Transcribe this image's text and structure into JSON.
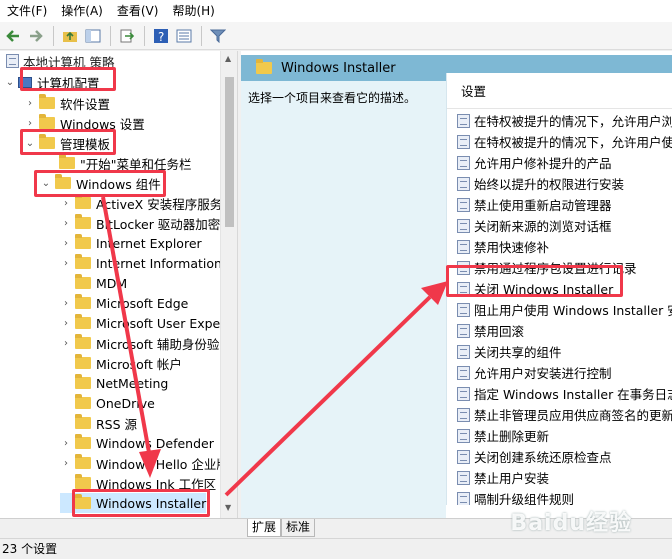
{
  "menu": [
    "文件(F)",
    "操作(A)",
    "查看(V)",
    "帮助(H)"
  ],
  "tree": {
    "root": "本地计算机 策略",
    "items": [
      {
        "label": "计算机配置",
        "level": 0,
        "expanded": true,
        "icon": "computer-icon"
      },
      {
        "label": "软件设置",
        "level": 1
      },
      {
        "label": "Windows 设置",
        "level": 1
      },
      {
        "label": "管理模板",
        "level": 1,
        "expanded": true
      },
      {
        "label": "\"开始\"菜单和任务栏",
        "level": 2
      },
      {
        "label": "Windows 组件",
        "level": 2,
        "expanded": true
      },
      {
        "label": "ActiveX 安装程序服务",
        "level": 3
      },
      {
        "label": "BitLocker 驱动器加密",
        "level": 3
      },
      {
        "label": "Internet Explorer",
        "level": 3
      },
      {
        "label": "Internet Information",
        "level": 3
      },
      {
        "label": "MDM",
        "level": 3
      },
      {
        "label": "Microsoft Edge",
        "level": 3
      },
      {
        "label": "Microsoft User Expe",
        "level": 3
      },
      {
        "label": "Microsoft 辅助身份验",
        "level": 3
      },
      {
        "label": "Microsoft 帐户",
        "level": 3
      },
      {
        "label": "NetMeeting",
        "level": 3
      },
      {
        "label": "OneDrive",
        "level": 3
      },
      {
        "label": "RSS 源",
        "level": 3
      },
      {
        "label": "Windows Defender",
        "level": 3
      },
      {
        "label": "Windows Hello 企业版",
        "level": 3
      },
      {
        "label": "Windows Ink 工作区",
        "level": 3
      },
      {
        "label": "Windows Installer",
        "level": 3,
        "selected": true
      }
    ]
  },
  "right": {
    "header": "Windows Installer",
    "description": "选择一个项目来查看它的描述。",
    "column": "设置",
    "settings": [
      "在特权被提升的情况下，允许用户浏览",
      "在特权被提升的情况下，允许用户使用",
      "允许用户修补提升的产品",
      "始终以提升的权限进行安装",
      "禁止使用重新启动管理器",
      "关闭新来源的浏览对话框",
      "禁用快速修补",
      "禁用通过程序包设置进行记录",
      "关闭 Windows Installer",
      "阻止用户使用 Windows Installer 安装",
      "禁用回滚",
      "关闭共享的组件",
      "允许用户对安装进行控制",
      "指定 Windows Installer 在事务日志",
      "禁止非管理员应用供应商签名的更新",
      "禁止删除更新",
      "关闭创建系统还原检查点",
      "禁止用户安装",
      "嗝制升级组件规则"
    ]
  },
  "tabs": [
    "扩展",
    "标准"
  ],
  "status": "23 个设置",
  "watermark": "Baidu经验",
  "colors": {
    "highlight": "#f0384a",
    "header_bg": "#7eb8d4",
    "desc_bg": "#e6f3f8"
  }
}
